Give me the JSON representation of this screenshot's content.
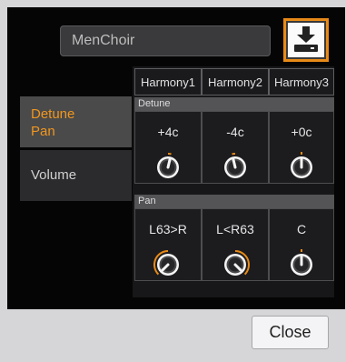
{
  "preset_name": "MenChoir",
  "save_icon": "save-download-icon",
  "tabs": [
    {
      "label_line1": "Detune",
      "label_line2": "Pan",
      "selected": true
    },
    {
      "label_line1": "Volume",
      "label_line2": "",
      "selected": false
    }
  ],
  "columns": [
    "Harmony1",
    "Harmony2",
    "Harmony3"
  ],
  "detune": {
    "label": "Detune",
    "values": [
      "+4c",
      "-4c",
      "+0c"
    ],
    "knob_levels": [
      0.55,
      0.45,
      0.5
    ]
  },
  "pan": {
    "label": "Pan",
    "values": [
      "L63>R",
      "L<R63",
      "C"
    ],
    "knob_levels": [
      0.0,
      1.0,
      0.5
    ]
  },
  "close_label": "Close",
  "accent_color": "#e88a17"
}
